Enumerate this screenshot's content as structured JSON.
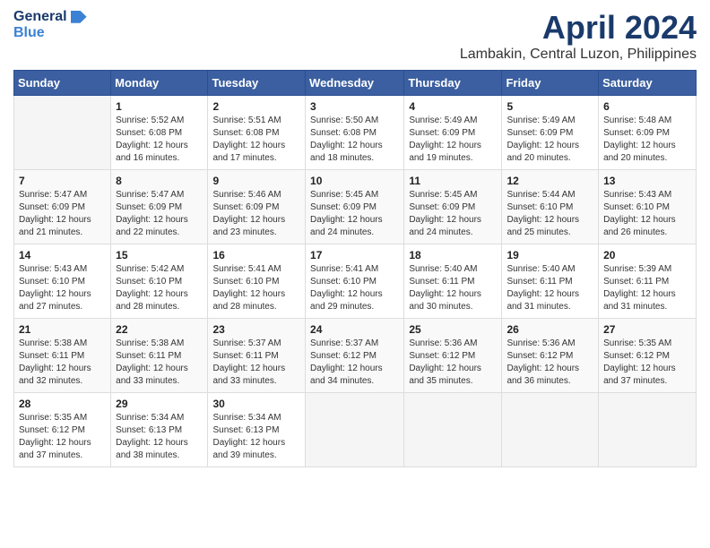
{
  "header": {
    "logo_general": "General",
    "logo_blue": "Blue",
    "month_title": "April 2024",
    "location": "Lambakin, Central Luzon, Philippines"
  },
  "calendar": {
    "headers": [
      "Sunday",
      "Monday",
      "Tuesday",
      "Wednesday",
      "Thursday",
      "Friday",
      "Saturday"
    ],
    "weeks": [
      [
        {
          "day": "",
          "info": ""
        },
        {
          "day": "1",
          "info": "Sunrise: 5:52 AM\nSunset: 6:08 PM\nDaylight: 12 hours\nand 16 minutes."
        },
        {
          "day": "2",
          "info": "Sunrise: 5:51 AM\nSunset: 6:08 PM\nDaylight: 12 hours\nand 17 minutes."
        },
        {
          "day": "3",
          "info": "Sunrise: 5:50 AM\nSunset: 6:08 PM\nDaylight: 12 hours\nand 18 minutes."
        },
        {
          "day": "4",
          "info": "Sunrise: 5:49 AM\nSunset: 6:09 PM\nDaylight: 12 hours\nand 19 minutes."
        },
        {
          "day": "5",
          "info": "Sunrise: 5:49 AM\nSunset: 6:09 PM\nDaylight: 12 hours\nand 20 minutes."
        },
        {
          "day": "6",
          "info": "Sunrise: 5:48 AM\nSunset: 6:09 PM\nDaylight: 12 hours\nand 20 minutes."
        }
      ],
      [
        {
          "day": "7",
          "info": "Sunrise: 5:47 AM\nSunset: 6:09 PM\nDaylight: 12 hours\nand 21 minutes."
        },
        {
          "day": "8",
          "info": "Sunrise: 5:47 AM\nSunset: 6:09 PM\nDaylight: 12 hours\nand 22 minutes."
        },
        {
          "day": "9",
          "info": "Sunrise: 5:46 AM\nSunset: 6:09 PM\nDaylight: 12 hours\nand 23 minutes."
        },
        {
          "day": "10",
          "info": "Sunrise: 5:45 AM\nSunset: 6:09 PM\nDaylight: 12 hours\nand 24 minutes."
        },
        {
          "day": "11",
          "info": "Sunrise: 5:45 AM\nSunset: 6:09 PM\nDaylight: 12 hours\nand 24 minutes."
        },
        {
          "day": "12",
          "info": "Sunrise: 5:44 AM\nSunset: 6:10 PM\nDaylight: 12 hours\nand 25 minutes."
        },
        {
          "day": "13",
          "info": "Sunrise: 5:43 AM\nSunset: 6:10 PM\nDaylight: 12 hours\nand 26 minutes."
        }
      ],
      [
        {
          "day": "14",
          "info": "Sunrise: 5:43 AM\nSunset: 6:10 PM\nDaylight: 12 hours\nand 27 minutes."
        },
        {
          "day": "15",
          "info": "Sunrise: 5:42 AM\nSunset: 6:10 PM\nDaylight: 12 hours\nand 28 minutes."
        },
        {
          "day": "16",
          "info": "Sunrise: 5:41 AM\nSunset: 6:10 PM\nDaylight: 12 hours\nand 28 minutes."
        },
        {
          "day": "17",
          "info": "Sunrise: 5:41 AM\nSunset: 6:10 PM\nDaylight: 12 hours\nand 29 minutes."
        },
        {
          "day": "18",
          "info": "Sunrise: 5:40 AM\nSunset: 6:11 PM\nDaylight: 12 hours\nand 30 minutes."
        },
        {
          "day": "19",
          "info": "Sunrise: 5:40 AM\nSunset: 6:11 PM\nDaylight: 12 hours\nand 31 minutes."
        },
        {
          "day": "20",
          "info": "Sunrise: 5:39 AM\nSunset: 6:11 PM\nDaylight: 12 hours\nand 31 minutes."
        }
      ],
      [
        {
          "day": "21",
          "info": "Sunrise: 5:38 AM\nSunset: 6:11 PM\nDaylight: 12 hours\nand 32 minutes."
        },
        {
          "day": "22",
          "info": "Sunrise: 5:38 AM\nSunset: 6:11 PM\nDaylight: 12 hours\nand 33 minutes."
        },
        {
          "day": "23",
          "info": "Sunrise: 5:37 AM\nSunset: 6:11 PM\nDaylight: 12 hours\nand 33 minutes."
        },
        {
          "day": "24",
          "info": "Sunrise: 5:37 AM\nSunset: 6:12 PM\nDaylight: 12 hours\nand 34 minutes."
        },
        {
          "day": "25",
          "info": "Sunrise: 5:36 AM\nSunset: 6:12 PM\nDaylight: 12 hours\nand 35 minutes."
        },
        {
          "day": "26",
          "info": "Sunrise: 5:36 AM\nSunset: 6:12 PM\nDaylight: 12 hours\nand 36 minutes."
        },
        {
          "day": "27",
          "info": "Sunrise: 5:35 AM\nSunset: 6:12 PM\nDaylight: 12 hours\nand 37 minutes."
        }
      ],
      [
        {
          "day": "28",
          "info": "Sunrise: 5:35 AM\nSunset: 6:12 PM\nDaylight: 12 hours\nand 37 minutes."
        },
        {
          "day": "29",
          "info": "Sunrise: 5:34 AM\nSunset: 6:13 PM\nDaylight: 12 hours\nand 38 minutes."
        },
        {
          "day": "30",
          "info": "Sunrise: 5:34 AM\nSunset: 6:13 PM\nDaylight: 12 hours\nand 39 minutes."
        },
        {
          "day": "",
          "info": ""
        },
        {
          "day": "",
          "info": ""
        },
        {
          "day": "",
          "info": ""
        },
        {
          "day": "",
          "info": ""
        }
      ]
    ]
  }
}
